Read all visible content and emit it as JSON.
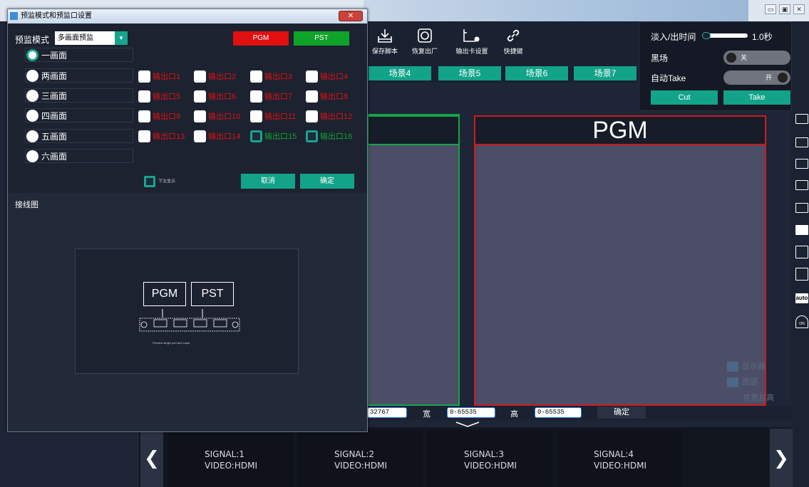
{
  "app": {
    "window_controls": [
      "▭",
      "▣",
      "✕"
    ],
    "toolbar": [
      {
        "label": "保存脚本",
        "icon": "save-script-icon"
      },
      {
        "label": "恢复出厂",
        "icon": "factory-reset-icon"
      },
      {
        "label": "输出卡设置",
        "icon": "output-card-settings-icon"
      },
      {
        "label": "快捷键",
        "icon": "shortcut-link-icon"
      }
    ],
    "scenes": [
      "场景4",
      "场景5",
      "场景6",
      "场景7"
    ],
    "pgm_title": "PGM",
    "size_bar": {
      "x_value": "32767",
      "width_label": "宽",
      "width_value": "0-65535",
      "height_label": "高",
      "height_value": "0-65535",
      "ok_label": "确定"
    },
    "signals": [
      {
        "name": "SIGNAL:1",
        "type": "VIDEO:HDMI"
      },
      {
        "name": "SIGNAL:2",
        "type": "VIDEO:HDMI"
      },
      {
        "name": "SIGNAL:3",
        "type": "VIDEO:HDMI"
      },
      {
        "name": "SIGNAL:4",
        "type": "VIDEO:HDMI"
      }
    ],
    "nav": {
      "prev": "❮",
      "next": "❯"
    },
    "overlay": {
      "fade_label": "淡入/出时间",
      "fade_value": "1.0秒",
      "black_label": "黑场",
      "black_state": "关",
      "auto_take_label": "自动Take",
      "auto_take_state": "开",
      "cut_label": "Cut",
      "take_label": "Take"
    },
    "legend": [
      "显示器",
      "图层",
      "总宽总高"
    ],
    "right_icons": [
      "monitor-icon",
      "window-icon",
      "layer-icon",
      "image-icon",
      "image-add-icon",
      "close-box-icon",
      "copy-icon",
      "paste-icon",
      "auto-icon",
      "on-icon"
    ],
    "right_icon_labels": {
      "auto": "auto",
      "on": "ON"
    }
  },
  "dialog": {
    "title": "预监模式和预监口设置",
    "close": "✕",
    "mode_label": "预监模式",
    "mode_value": "多画面预监",
    "pgm_button": "PGM",
    "pst_button": "PST",
    "modes": [
      "一画面",
      "两画面",
      "三画面",
      "四画面",
      "五画面",
      "六画面"
    ],
    "selected_mode": "一画面",
    "outputs": [
      "输出口1",
      "输出口2",
      "输出口3",
      "输出口4",
      "输出口5",
      "输出口6",
      "输出口7",
      "输出口8",
      "输出口9",
      "输出口10",
      "输出口11",
      "输出口12",
      "输出口13",
      "输出口14",
      "输出口15",
      "输出口16"
    ],
    "checked_outputs": [
      "输出口15",
      "输出口16"
    ],
    "show_below_label": "下次显示",
    "cancel_label": "取消",
    "ok_label": "确定",
    "wiring_label": "接线图",
    "wiring": {
      "pgm": "PGM",
      "pst": "PST",
      "caption": "Preview single port and Layer"
    }
  },
  "colors": {
    "accent": "#12a389",
    "pgm_red": "#e01010",
    "pst_green": "#10a32a",
    "bg": "#1d2536"
  }
}
